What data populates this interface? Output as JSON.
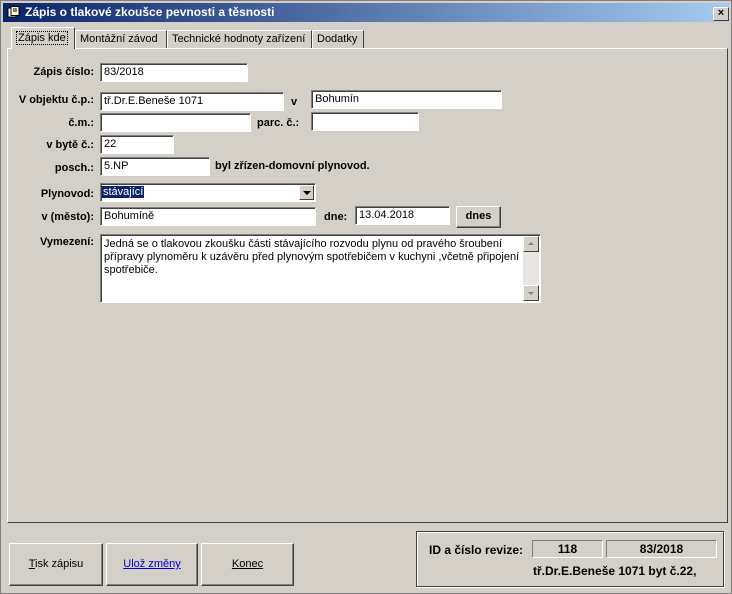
{
  "window": {
    "title": "Zápis o tlakové zkoušce pevnosti a těsnosti",
    "close_glyph": "×"
  },
  "tabs": [
    {
      "label": "Zápis kde",
      "active": true
    },
    {
      "label": "Montážní závod",
      "active": false
    },
    {
      "label": "Technické hodnoty zařízení",
      "active": false
    },
    {
      "label": "Dodatky",
      "active": false
    }
  ],
  "form": {
    "zapis_cislo_label": "Zápis číslo:",
    "zapis_cislo_value": "83/2018",
    "objekt_cp_label": "V objektu č.p.:",
    "objekt_cp_value": "tř.Dr.E.Beneše 1071",
    "v_label": "v",
    "obec_value": "Bohumín",
    "cm_label": "č.m.:",
    "cm_value": "",
    "parc_label": "parc. č.:",
    "parc_value": "",
    "byt_label": "v bytě č.:",
    "byt_value": "22",
    "posch_label": "posch.:",
    "posch_value": "5.NP",
    "zrizen_text": "byl zřízen-domovní plynovod.",
    "plynovod_label": "Plynovod:",
    "plynovod_value": "stávající",
    "mesto_label": "v (město):",
    "mesto_value": "Bohumíně",
    "dne_label": "dne:",
    "dne_value": "13.04.2018",
    "dnes_button": "dnes",
    "vymezeni_label": "Vymezení:",
    "vymezeni_value": "Jedná se o tlakovou zkoušku části stávajícího rozvodu plynu od pravého šroubení přípravy plynoměru k uzávěru před plynovým spotřebičem v kuchyni ,včetně připojení spotřebiče."
  },
  "buttons": {
    "tisk_first": "T",
    "tisk_rest": "isk zápisu",
    "uloz_first": "U",
    "uloz_rest": "lož změny",
    "konec_first": "K",
    "konec_rest": "onec"
  },
  "info": {
    "label": "ID a číslo revize:",
    "id": "118",
    "cislo": "83/2018",
    "address": "tř.Dr.E.Beneše 1071 byt č.22,"
  },
  "colors": {
    "face": "#d4d0c8",
    "title_start": "#0a246a",
    "title_end": "#a6caf0",
    "link_blue": "#0000cc"
  }
}
